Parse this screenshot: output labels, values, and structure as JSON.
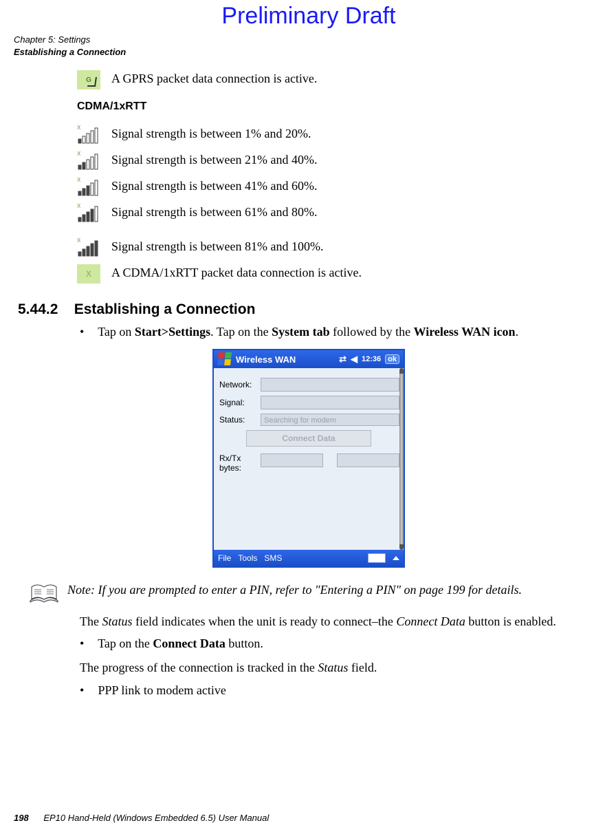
{
  "draft_header": "Preliminary Draft",
  "chapter": {
    "line1": "Chapter 5: Settings",
    "line2": "Establishing a Connection"
  },
  "gprs_active": "A GPRS packet data connection is active.",
  "cdma_heading": "CDMA/1xRTT",
  "signals": [
    "Signal strength is between 1% and 20%.",
    "Signal strength is between 21% and 40%.",
    "Signal strength is between 41% and 60%.",
    "Signal strength is between 61% and 80%.",
    "Signal strength is between 81% and 100%."
  ],
  "cdma_active": "A CDMA/1xRTT packet data connection is active.",
  "section": {
    "number": "5.44.2",
    "title": "Establishing a Connection"
  },
  "instruction1": {
    "pre": "Tap on ",
    "bold1": "Start>Settings",
    "mid": ". Tap on the ",
    "bold2": "System tab",
    "mid2": " followed by the ",
    "bold3": "Wireless WAN icon",
    "post": "."
  },
  "device": {
    "title": "Wireless WAN",
    "time": "12:36",
    "ok": "ok",
    "labels": {
      "network": "Network:",
      "signal": "Signal:",
      "status": "Status:",
      "rxtx": "Rx/Tx bytes:"
    },
    "status_value": "Searching for modem",
    "connect_label": "Connect Data",
    "menu": {
      "file": "File",
      "tools": "Tools",
      "sms": "SMS"
    }
  },
  "note": {
    "label": "Note:",
    "text": " If you are prompted to enter a PIN, refer to \"Entering a PIN\" on page 199 for details."
  },
  "para_status": {
    "pre": "The ",
    "i1": "Status",
    "mid": " field indicates when the unit is ready to connect–the ",
    "i2": "Connect Data",
    "post": " button is enabled."
  },
  "instruction2": {
    "pre": "Tap on the ",
    "bold": "Connect Data",
    "post": " button."
  },
  "para_progress": {
    "pre": "The progress of the connection is tracked in the ",
    "i1": "Status",
    "post": " field."
  },
  "bullet3": "PPP link to modem active",
  "footer": {
    "page": "198",
    "text": "EP10 Hand-Held (Windows Embedded 6.5) User Manual"
  }
}
